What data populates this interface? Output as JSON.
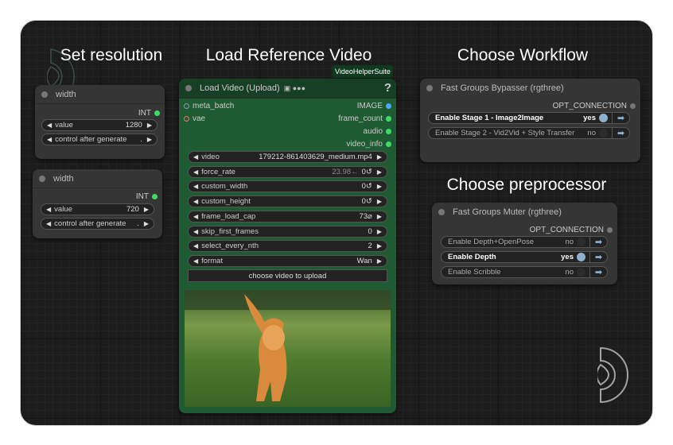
{
  "headings": {
    "set_resolution": "Set resolution",
    "load_reference_video": "Load Reference Video",
    "choose_workflow": "Choose Workflow",
    "choose_preprocessor": "Choose preprocessor"
  },
  "width_nodes": [
    {
      "title": "width",
      "output": "INT",
      "value_label": "value",
      "value": "1280",
      "control_label": "control after generate",
      "control_value": "."
    },
    {
      "title": "width",
      "output": "INT",
      "value_label": "value",
      "value": "720",
      "control_label": "control after generate",
      "control_value": "."
    }
  ],
  "load_video": {
    "badge": "VideoHelperSuite",
    "title": "Load Video (Upload)",
    "help": "?",
    "inputs": [
      "meta_batch",
      "vae"
    ],
    "outputs": [
      "IMAGE",
      "frame_count",
      "audio",
      "video_info"
    ],
    "widgets": [
      {
        "label": "video",
        "value": "179212-861403629_medium.mp4"
      },
      {
        "label": "force_rate",
        "hint": "23.98←",
        "value": "0↺"
      },
      {
        "label": "custom_width",
        "value": "0↺"
      },
      {
        "label": "custom_height",
        "value": "0↺"
      },
      {
        "label": "frame_load_cap",
        "value": "73⌀"
      },
      {
        "label": "skip_first_frames",
        "value": "0"
      },
      {
        "label": "select_every_nth",
        "value": "2"
      },
      {
        "label": "format",
        "value": "Wan"
      }
    ],
    "upload_button": "choose video to upload"
  },
  "bypasser": {
    "title": "Fast Groups Bypasser (rgthree)",
    "output": "OPT_CONNECTION",
    "toggles": [
      {
        "label": "Enable Stage 1 - Image2Image",
        "state": "yes"
      },
      {
        "label": "Enable Stage 2 - Vid2Vid + Style Transfer",
        "state": "no"
      }
    ]
  },
  "muter": {
    "title": "Fast Groups Muter (rgthree)",
    "output": "OPT_CONNECTION",
    "toggles": [
      {
        "label": "Enable Depth+OpenPose",
        "state": "no"
      },
      {
        "label": "Enable Depth",
        "state": "yes"
      },
      {
        "label": "Enable Scribble",
        "state": "no"
      }
    ]
  },
  "colors": {
    "node_bg": "#353535",
    "video_node": "#1e5a32",
    "port_image": "#4aa8ff",
    "port_green": "#3ddc64",
    "port_vae": "#ff6b6b",
    "port_meta": "#9b8fc0",
    "toggle_on": "#8fb0cc"
  }
}
